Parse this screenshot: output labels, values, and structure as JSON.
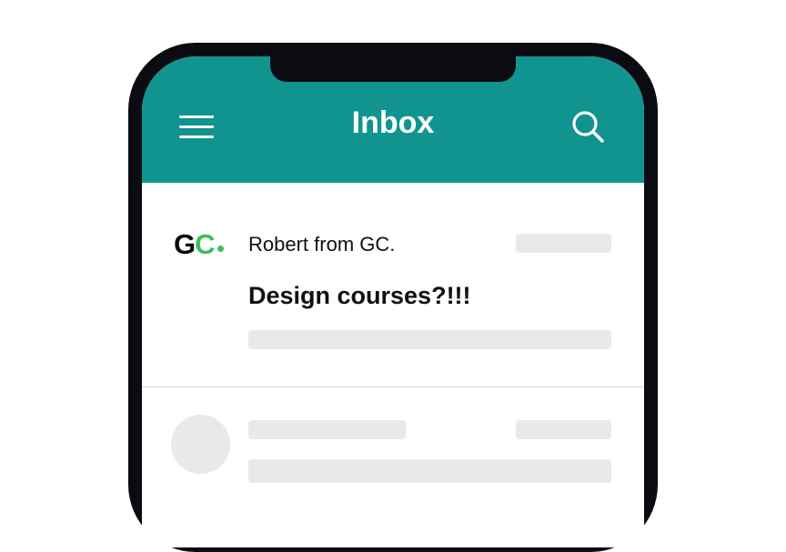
{
  "header": {
    "title": "Inbox",
    "background_color": "#11948f",
    "menu_icon": "hamburger-menu-icon",
    "search_icon": "search-icon"
  },
  "messages": [
    {
      "logo": {
        "letter_1": "G",
        "letter_2": "C",
        "brand_color": "#3fbe5a"
      },
      "sender": "Robert from GC.",
      "subject": "Design courses?!!!"
    }
  ]
}
